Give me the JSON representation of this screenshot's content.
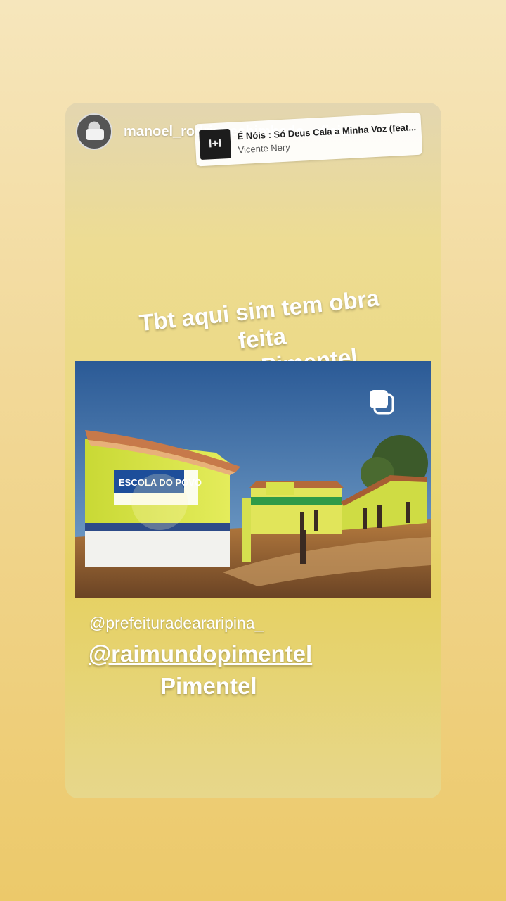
{
  "story": {
    "username": "manoel_rodriguesbimbado_oficial",
    "avatar_icon": "profile-avatar",
    "music": {
      "icon": "album-art-icon",
      "title": "É Nóis : Só Deus Cala a Minha Voz (feat...",
      "artist": "Vicente Nery",
      "album_label": "I+I"
    },
    "caption": {
      "line1": "Tbt aqui sim tem obra",
      "line2": "feita",
      "line3": "Papoca Pimentel"
    },
    "photo": {
      "description_icon": "school-photo",
      "sign_text": "ESCOLA DO POVO",
      "multi_icon": "copy-icon"
    },
    "mentions": {
      "first": "@prefeituradeararipina_",
      "second": "@raimundopimentel",
      "third": "Pimentel"
    }
  },
  "colors": {
    "background_top": "#f6e6bc",
    "background_bottom": "#ecc96a",
    "text": "#ffffff"
  }
}
